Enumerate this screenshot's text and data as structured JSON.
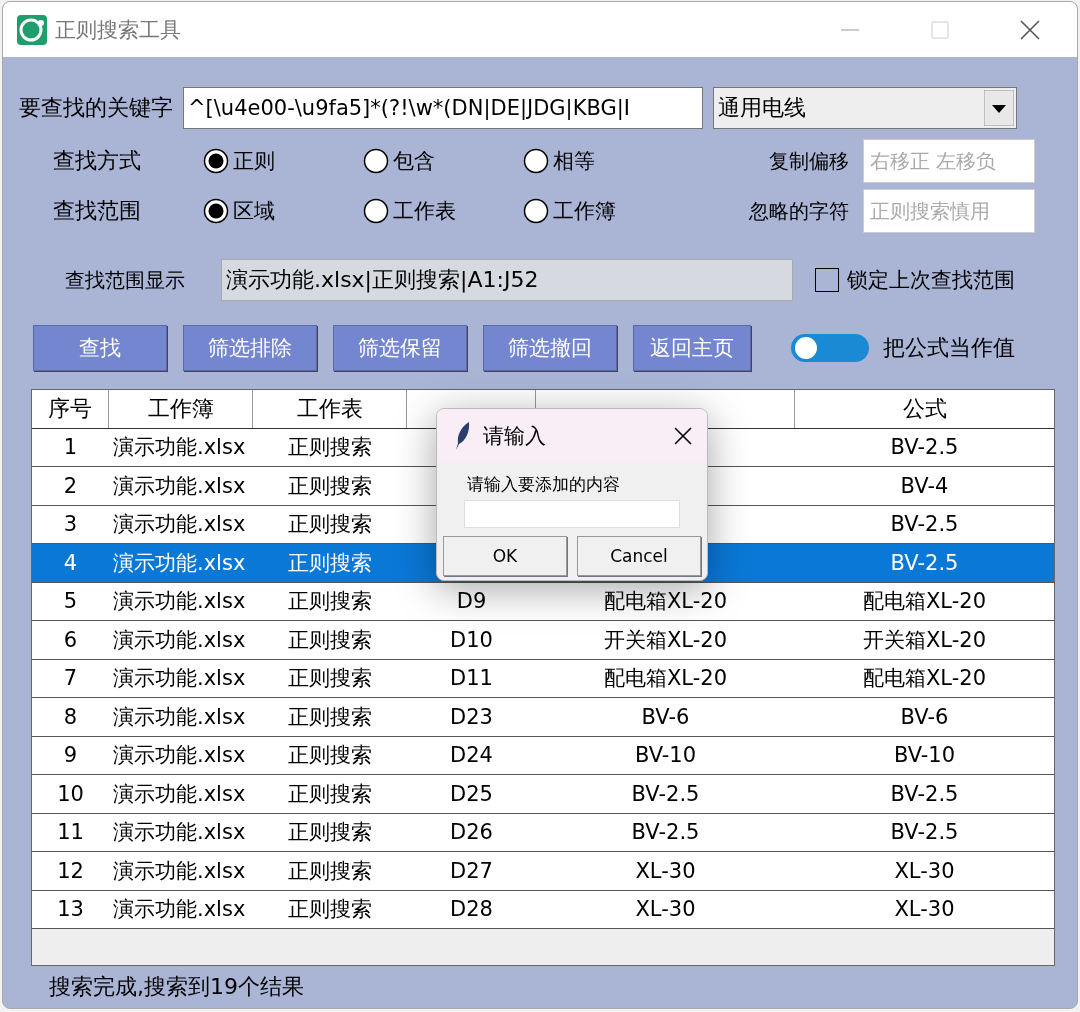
{
  "window": {
    "title": "正则搜索工具"
  },
  "keyword": {
    "label": "要查找的关键字",
    "value": "^[\\u4e00-\\u9fa5]*(?!\\w*(DN|DE|JDG|KBG|I",
    "preset": "通用电线"
  },
  "search_mode": {
    "label": "查找方式",
    "options": [
      {
        "label": "正则",
        "selected": true
      },
      {
        "label": "包含",
        "selected": false
      },
      {
        "label": "相等",
        "selected": false
      }
    ]
  },
  "search_scope": {
    "label": "查找范围",
    "options": [
      {
        "label": "区域",
        "selected": true
      },
      {
        "label": "工作表",
        "selected": false
      },
      {
        "label": "工作簿",
        "selected": false
      }
    ]
  },
  "copy_offset": {
    "label": "复制偏移",
    "placeholder": "右移正 左移负"
  },
  "ignore_chars": {
    "label": "忽略的字符",
    "placeholder": "正则搜索慎用"
  },
  "range_display": {
    "label": "查找范围显示",
    "value": "演示功能.xlsx|正则搜索|A1:J52"
  },
  "lock_range": {
    "label": "锁定上次查找范围",
    "checked": false
  },
  "buttons": [
    "查找",
    "筛选排除",
    "筛选保留",
    "筛选撤回",
    "返回主页"
  ],
  "formula_toggle": {
    "label": "把公式当作值",
    "on": false
  },
  "table": {
    "columns": [
      "序号",
      "工作簿",
      "工作表",
      "公式"
    ],
    "rows": [
      {
        "no": "1",
        "workbook": "演示功能.xlsx",
        "sheet": "正则搜索",
        "formula": "BV-2.5",
        "selected": false
      },
      {
        "no": "2",
        "workbook": "演示功能.xlsx",
        "sheet": "正则搜索",
        "formula": "BV-4",
        "selected": false
      },
      {
        "no": "3",
        "workbook": "演示功能.xlsx",
        "sheet": "正则搜索",
        "formula": "BV-2.5",
        "selected": false
      },
      {
        "no": "4",
        "workbook": "演示功能.xlsx",
        "sheet": "正则搜索",
        "formula": "BV-2.5",
        "selected": true
      },
      {
        "no": "5",
        "workbook": "演示功能.xlsx",
        "sheet": "正则搜索",
        "cell": "D9",
        "value": "配电箱XL-20",
        "formula": "配电箱XL-20",
        "selected": false
      },
      {
        "no": "6",
        "workbook": "演示功能.xlsx",
        "sheet": "正则搜索",
        "cell": "D10",
        "value": "开关箱XL-20",
        "formula": "开关箱XL-20",
        "selected": false
      },
      {
        "no": "7",
        "workbook": "演示功能.xlsx",
        "sheet": "正则搜索",
        "cell": "D11",
        "value": "配电箱XL-20",
        "formula": "配电箱XL-20",
        "selected": false
      },
      {
        "no": "8",
        "workbook": "演示功能.xlsx",
        "sheet": "正则搜索",
        "cell": "D23",
        "value": "BV-6",
        "formula": "BV-6",
        "selected": false
      },
      {
        "no": "9",
        "workbook": "演示功能.xlsx",
        "sheet": "正则搜索",
        "cell": "D24",
        "value": "BV-10",
        "formula": "BV-10",
        "selected": false
      },
      {
        "no": "10",
        "workbook": "演示功能.xlsx",
        "sheet": "正则搜索",
        "cell": "D25",
        "value": "BV-2.5",
        "formula": "BV-2.5",
        "selected": false
      },
      {
        "no": "11",
        "workbook": "演示功能.xlsx",
        "sheet": "正则搜索",
        "cell": "D26",
        "value": "BV-2.5",
        "formula": "BV-2.5",
        "selected": false
      },
      {
        "no": "12",
        "workbook": "演示功能.xlsx",
        "sheet": "正则搜索",
        "cell": "D27",
        "value": "XL-30",
        "formula": "XL-30",
        "selected": false
      },
      {
        "no": "13",
        "workbook": "演示功能.xlsx",
        "sheet": "正则搜索",
        "cell": "D28",
        "value": "XL-30",
        "formula": "XL-30",
        "selected": false
      }
    ]
  },
  "dialog": {
    "title": "请输入",
    "prompt": "请输入要添加的内容",
    "buttons": [
      "OK",
      "Cancel"
    ]
  },
  "status_bar": "搜索完成,搜索到19个结果"
}
